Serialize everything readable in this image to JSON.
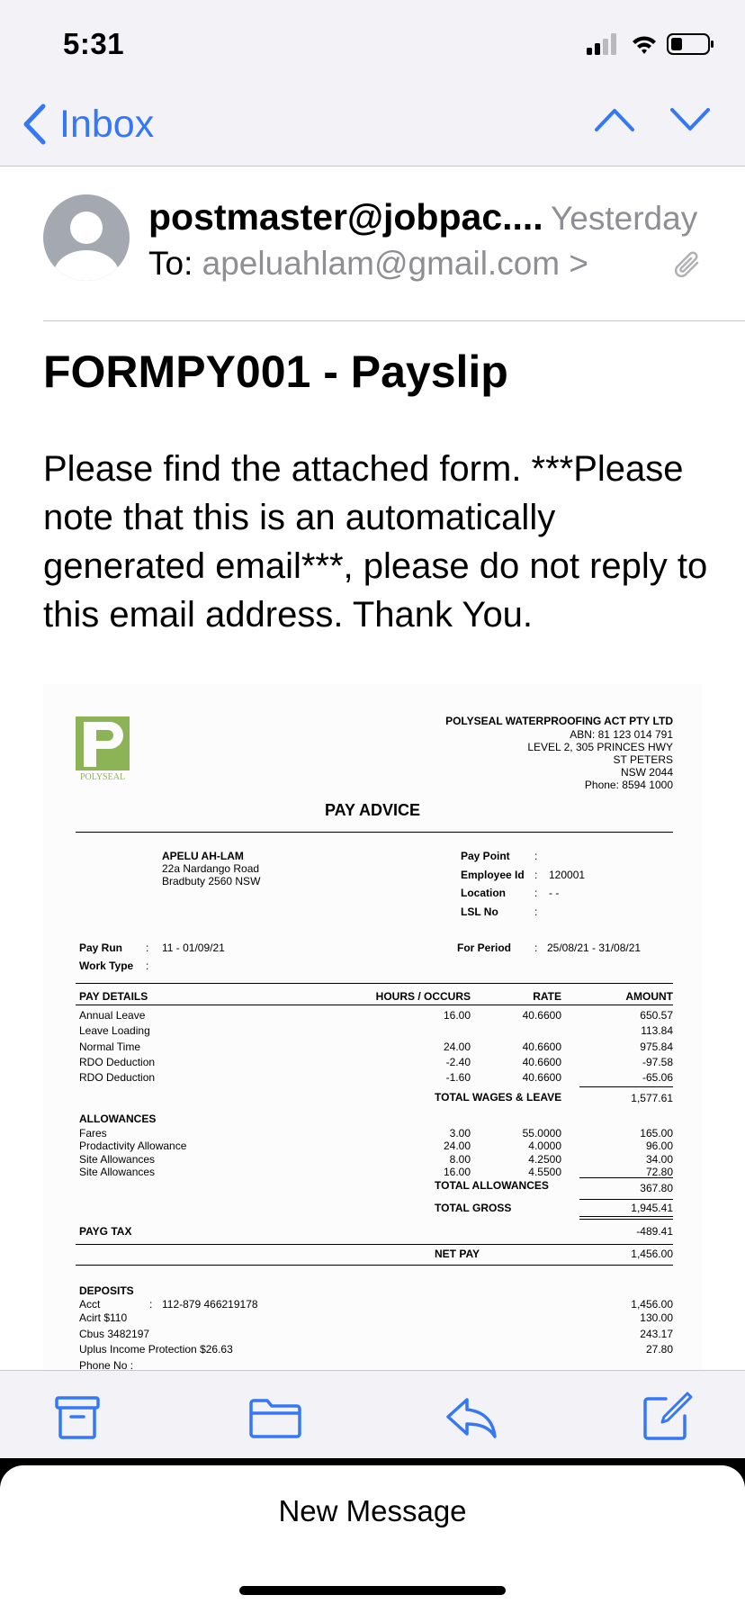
{
  "status_bar": {
    "time": "5:31",
    "icons": [
      "signal-icon",
      "wifi-icon",
      "battery-icon"
    ]
  },
  "nav": {
    "back_label": "Inbox",
    "icons": [
      "chevron-left-icon",
      "chevron-up-icon",
      "chevron-down-icon"
    ]
  },
  "colors": {
    "accent": "#3478f6",
    "secondary_text": "#8e8e93",
    "logo_green": "#8cb456",
    "bar_bg": "#f2f2f7"
  },
  "message": {
    "sender": "postmaster@jobpac....",
    "date": "Yesterday",
    "to_label": "To:",
    "to_address": "apeluahlam@gmail.com",
    "to_chevron": ">",
    "subject": "FORMPY001 - Payslip",
    "body": "Please find the attached form. ***Please note that this is an automatically generated email***, please do not reply to this email address. Thank You."
  },
  "payslip": {
    "logo_text": "POLYSEAL",
    "company": {
      "name": "POLYSEAL WATERPROOFING ACT PTY LTD",
      "abn": "ABN: 81 123 014 791",
      "address1": "LEVEL 2, 305 PRINCES HWY",
      "suburb": "ST PETERS",
      "state": "NSW  2044",
      "phone": "Phone: 8594 1000"
    },
    "title": "PAY ADVICE",
    "employee": {
      "name": "APELU AH-LAM",
      "street": "22a Nardango Road",
      "town": "Bradbuty   2560 NSW"
    },
    "info": [
      {
        "label": "Pay Point",
        "sep": ":",
        "value": ""
      },
      {
        "label": "Employee Id",
        "sep": ":",
        "value": "120001"
      },
      {
        "label": "Location",
        "sep": ":",
        "value": "- -"
      },
      {
        "label": "LSL No",
        "sep": ":",
        "value": ""
      }
    ],
    "pay_run": {
      "label": "Pay Run",
      "sep": ":",
      "value": "11 - 01/09/21"
    },
    "work_type": {
      "label": "Work Type",
      "sep": ":",
      "value": ""
    },
    "for_period": {
      "label": "For Period",
      "sep": ":",
      "value": "25/08/21 - 31/08/21"
    },
    "columns": {
      "details": "PAY DETAILS",
      "hours": "HOURS / OCCURS",
      "rate": "RATE",
      "amount": "AMOUNT"
    },
    "pay_rows": [
      {
        "desc": "Annual Leave",
        "hours": "16.00",
        "rate": "40.6600",
        "amount": "650.57"
      },
      {
        "desc": "Leave Loading",
        "hours": "",
        "rate": "",
        "amount": "113.84"
      },
      {
        "desc": "Normal Time",
        "hours": "24.00",
        "rate": "40.6600",
        "amount": "975.84"
      },
      {
        "desc": "RDO Deduction",
        "hours": "-2.40",
        "rate": "40.6600",
        "amount": "-97.58"
      },
      {
        "desc": "RDO Deduction",
        "hours": "-1.60",
        "rate": "40.6600",
        "amount": "-65.06"
      }
    ],
    "total_wages_label": "TOTAL WAGES & LEAVE",
    "total_wages": "1,577.61",
    "allowances_title": "ALLOWANCES",
    "allowance_rows": [
      {
        "desc": "Fares",
        "hours": "3.00",
        "rate": "55.0000",
        "amount": "165.00"
      },
      {
        "desc": "Prodactivity Allowance",
        "hours": "24.00",
        "rate": "4.0000",
        "amount": "96.00"
      },
      {
        "desc": "Site Allowances",
        "hours": "8.00",
        "rate": "4.2500",
        "amount": "34.00"
      },
      {
        "desc": "Site Allowances",
        "hours": "16.00",
        "rate": "4.5500",
        "amount": "72.80"
      }
    ],
    "total_allowances_label": "TOTAL ALLOWANCES",
    "total_allowances": "367.80",
    "total_gross_label": "TOTAL GROSS",
    "total_gross": "1,945.41",
    "payg_label": "PAYG TAX",
    "payg": "-489.41",
    "net_pay_label": "NET PAY",
    "net_pay": "1,456.00",
    "deposits_title": "DEPOSITS",
    "deposits": [
      {
        "desc": "Acct",
        "sep": ":",
        "detail": "112-879 466219178",
        "amount": "1,456.00"
      },
      {
        "desc": "Acirt $110",
        "sep": "",
        "detail": "",
        "amount": "130.00"
      },
      {
        "desc": "Cbus   3482197",
        "sep": "",
        "detail": "",
        "amount": "243.17"
      },
      {
        "desc": "Uplus Income Protection $26.63",
        "sep": "",
        "detail": "",
        "amount": "27.80"
      },
      {
        "desc": "Phone No :",
        "sep": "",
        "detail": "",
        "amount": ""
      }
    ]
  },
  "toolbar": {
    "icons": [
      "archive-icon",
      "folder-icon",
      "reply-icon",
      "compose-icon"
    ]
  },
  "sheet": {
    "label": "New Message"
  }
}
